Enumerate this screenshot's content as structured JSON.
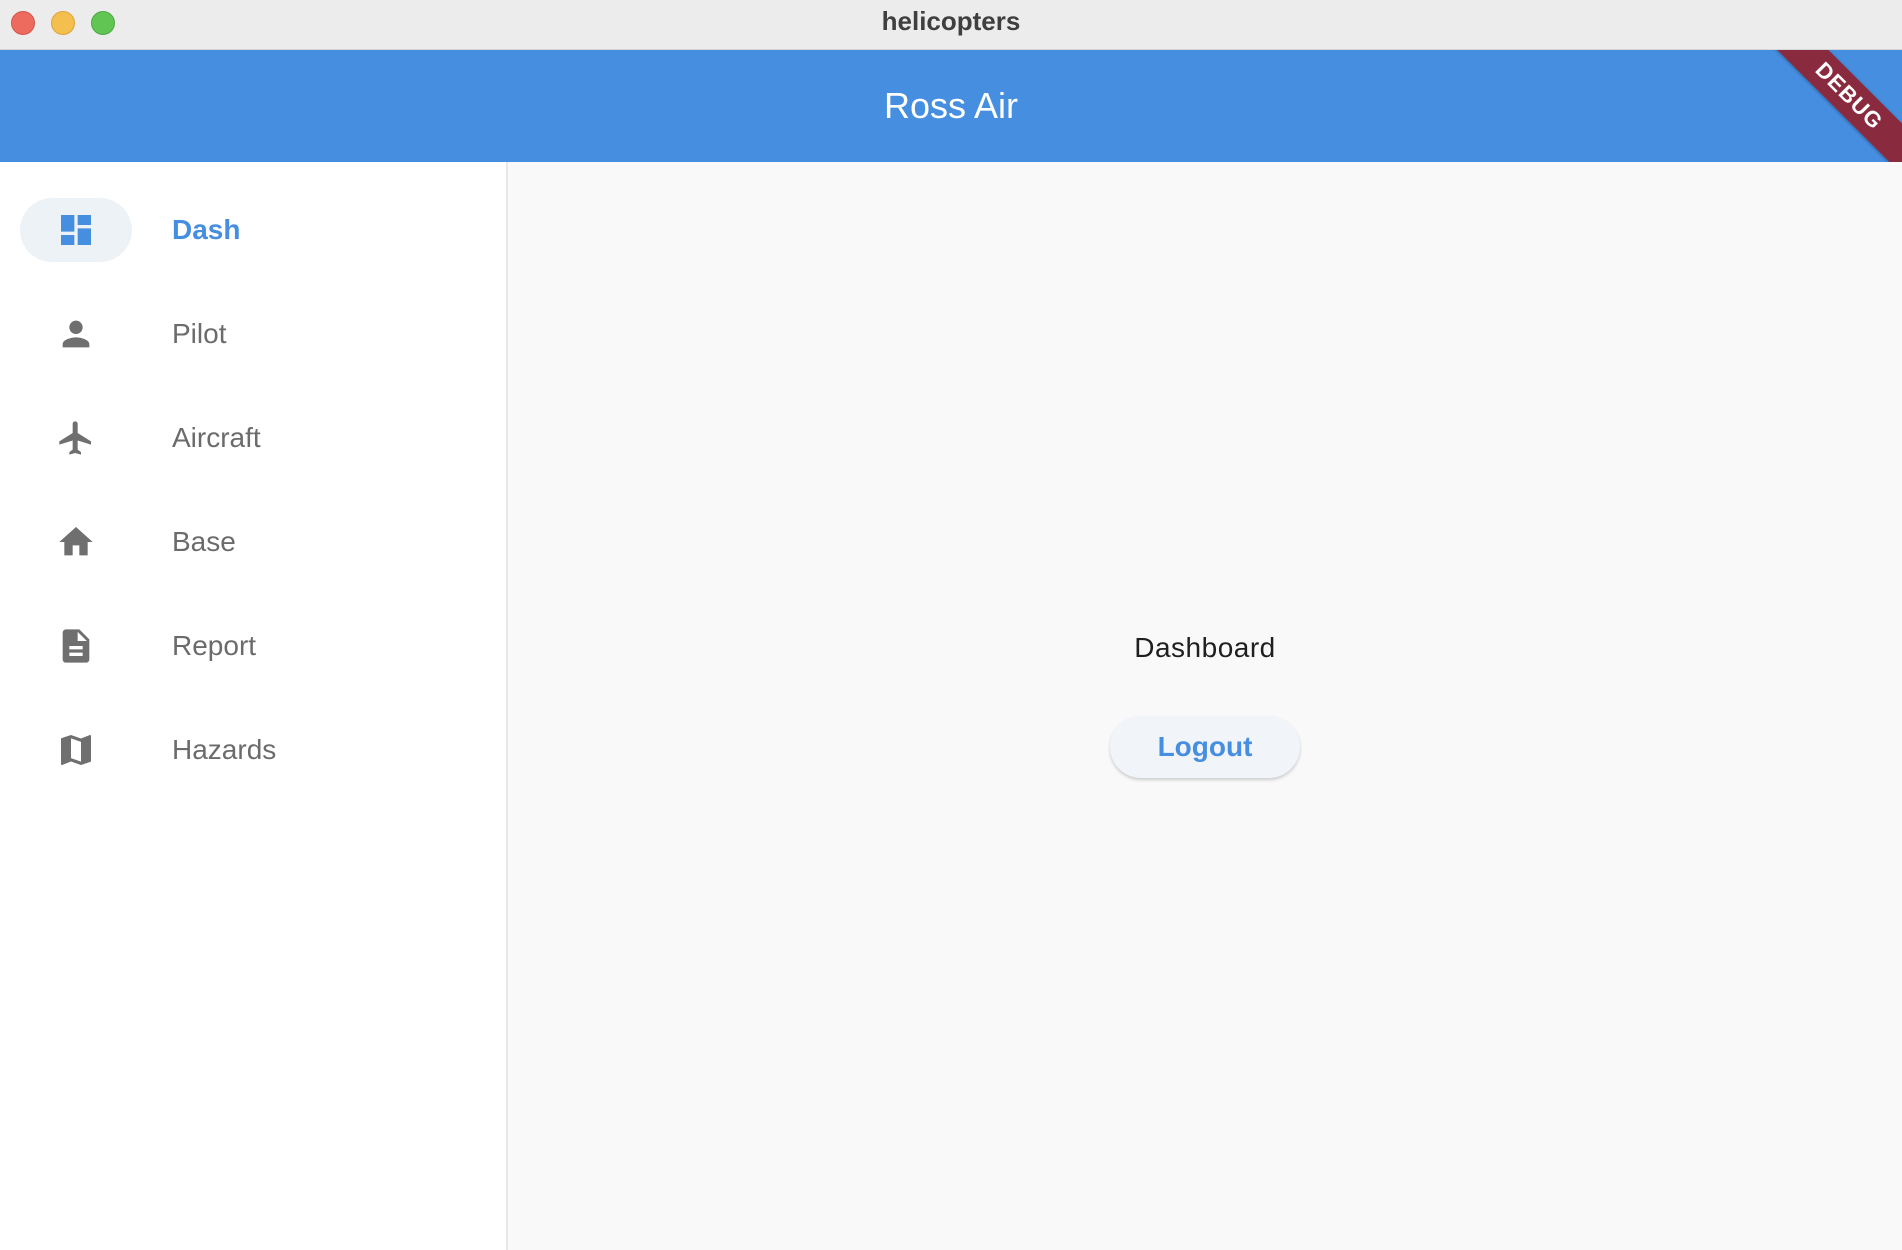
{
  "window": {
    "title": "helicopters"
  },
  "appbar": {
    "title": "Ross Air",
    "debug_banner": "DEBUG",
    "color": "#468ee0"
  },
  "sidebar": {
    "items": [
      {
        "label": "Dash",
        "icon": "dashboard-icon",
        "selected": true
      },
      {
        "label": "Pilot",
        "icon": "person-icon",
        "selected": false
      },
      {
        "label": "Aircraft",
        "icon": "airplane-icon",
        "selected": false
      },
      {
        "label": "Base",
        "icon": "home-icon",
        "selected": false
      },
      {
        "label": "Report",
        "icon": "document-icon",
        "selected": false
      },
      {
        "label": "Hazards",
        "icon": "map-icon",
        "selected": false
      }
    ]
  },
  "main": {
    "heading": "Dashboard",
    "logout_label": "Logout"
  }
}
